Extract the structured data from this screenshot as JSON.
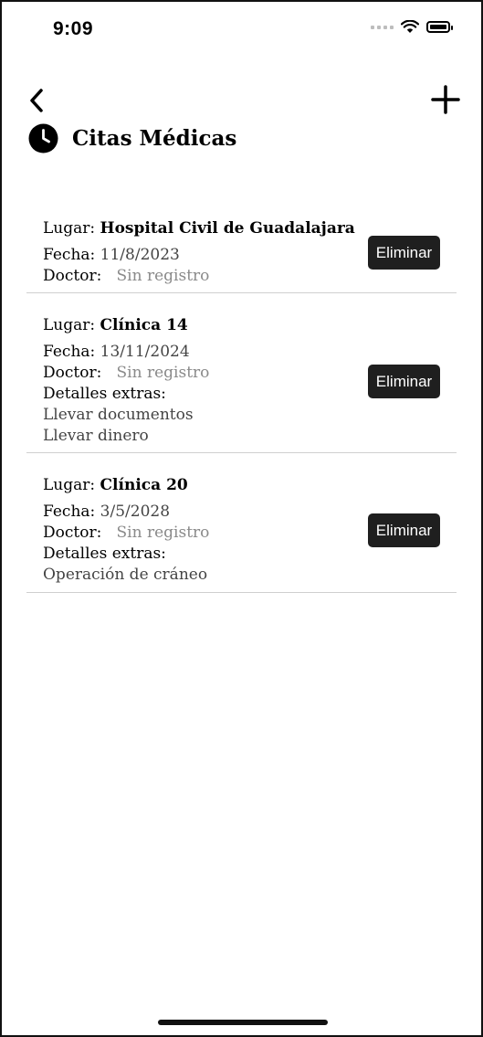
{
  "status_bar": {
    "time": "9:09"
  },
  "header": {
    "title": "Citas Médicas"
  },
  "labels": {
    "place": "Lugar:",
    "date": "Fecha:",
    "doctor": "Doctor:",
    "extra": "Detalles extras:",
    "delete": "Eliminar"
  },
  "appointments": [
    {
      "place": "Hospital Civil de Guadalajara",
      "date": "11/8/2023",
      "doctor": "Sin registro",
      "extra_lines": []
    },
    {
      "place": "Clínica 14",
      "date": "13/11/2024",
      "doctor": "Sin registro",
      "extra_lines": [
        "Llevar documentos",
        "Llevar dinero"
      ]
    },
    {
      "place": "Clínica 20",
      "date": "3/5/2028",
      "doctor": "Sin registro",
      "extra_lines": [
        "Operación de cráneo"
      ]
    }
  ]
}
